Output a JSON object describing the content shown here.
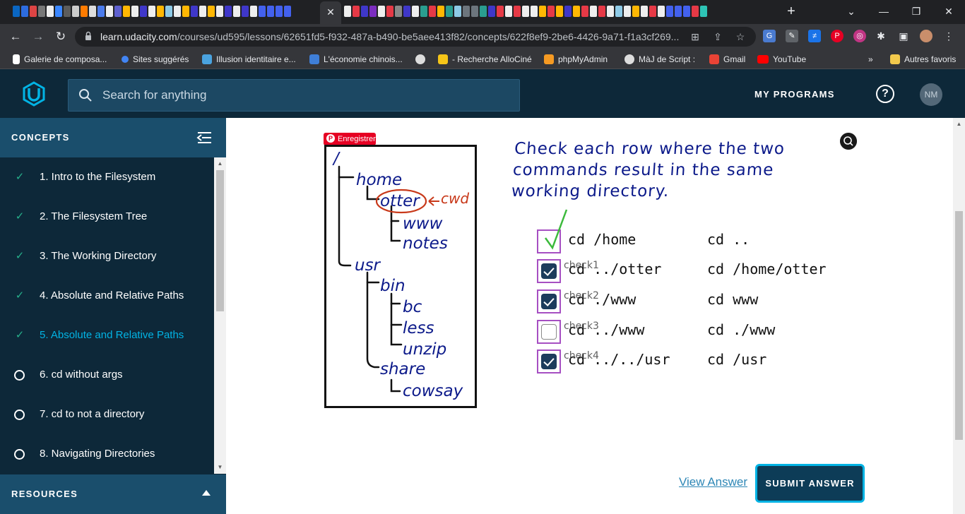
{
  "browser": {
    "active_tab_close": "✕",
    "new_tab": "+",
    "url_domain": "learn.udacity.com",
    "url_path": "/courses/ud595/lessons/62651fd5-f932-487a-b490-be5aee413f82/concepts/622f8ef9-2be6-4426-9a71-f1a3cf269...",
    "bookmarks": [
      {
        "label": "Galerie de composa...",
        "color": "#ffffff"
      },
      {
        "label": "Sites suggérés",
        "color": "#4285f4"
      },
      {
        "label": "Illusion identitaire e...",
        "color": "#4aa3df"
      },
      {
        "label": "L'économie chinois...",
        "color": "#3f7fd8"
      },
      {
        "label": "",
        "color": "#dddddd"
      },
      {
        "label": "- Recherche AlloCiné",
        "color": "#f5c518"
      },
      {
        "label": "phpMyAdmin",
        "color": "#f59a23"
      },
      {
        "label": "MàJ de Script :",
        "color": "#dddddd"
      },
      {
        "label": "Gmail",
        "color": "#ea4335"
      },
      {
        "label": "YouTube",
        "color": "#ff0000"
      }
    ],
    "more": "»",
    "other_bookmarks": "Autres favoris"
  },
  "header": {
    "search_placeholder": "Search for anything",
    "my_programs": "MY PROGRAMS",
    "help": "?",
    "avatar_initials": "NM"
  },
  "sidebar": {
    "title": "CONCEPTS",
    "items": [
      {
        "label": "1. Intro to the Filesystem",
        "status": "done"
      },
      {
        "label": "2. The Filesystem Tree",
        "status": "done"
      },
      {
        "label": "3. The Working Directory",
        "status": "done"
      },
      {
        "label": "4. Absolute and Relative Paths",
        "status": "done"
      },
      {
        "label": "5. Absolute and Relative Paths",
        "status": "active"
      },
      {
        "label": "6. cd without args",
        "status": "todo"
      },
      {
        "label": "7. cd to not a directory",
        "status": "todo"
      },
      {
        "label": "8. Navigating Directories",
        "status": "todo"
      }
    ],
    "check_glyph": "✓",
    "resources": "RESOURCES"
  },
  "content": {
    "pin_label": "Enregistrer",
    "tree": {
      "root": "/",
      "home": "home",
      "otter": "otter",
      "cwd": "cwd",
      "www": "www",
      "notes": "notes",
      "usr": "usr",
      "bin": "bin",
      "bc": "bc",
      "less": "less",
      "unzip": "unzip",
      "share": "share",
      "cowsay": "cowsay"
    },
    "question_lines": [
      "Check each row where the two",
      "commands result in the same",
      "working directory."
    ],
    "rows": [
      {
        "label": "",
        "cmd1": "cd /home",
        "cmd2": "cd ..",
        "checked": false,
        "example": true
      },
      {
        "label": "check1",
        "cmd1": "cd ../otter",
        "cmd2": "cd /home/otter",
        "checked": true
      },
      {
        "label": "check2",
        "cmd1": "cd ./www",
        "cmd2": "cd www",
        "checked": true
      },
      {
        "label": "check3",
        "cmd1": "cd ../www",
        "cmd2": "cd ./www",
        "checked": false
      },
      {
        "label": "check4",
        "cmd1": "cd ../../usr",
        "cmd2": "cd /usr",
        "checked": true
      }
    ],
    "view_answer": "View Answer",
    "submit": "SUBMIT ANSWER"
  },
  "colors": {
    "udacity_navy": "#0d2839",
    "sidebar_header": "#1a4e6c",
    "accent_cyan": "#02b3e4",
    "check_green": "#26b08b",
    "checkbox_border": "#a64fc2",
    "question_ink": "#0c1a8a"
  }
}
